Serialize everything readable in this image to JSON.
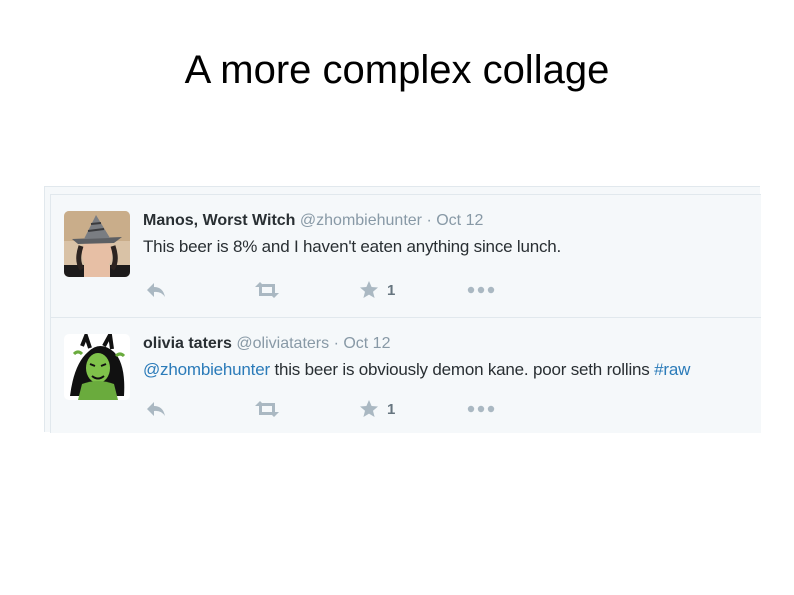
{
  "slide": {
    "title": "A more complex collage"
  },
  "tweets": [
    {
      "fullname": "Manos, Worst Witch",
      "username": "@zhombiehunter",
      "separator": "·",
      "date": "Oct 12",
      "text": "This beer is 8% and I haven't eaten anything since lunch.",
      "favorite_count": "1",
      "actions": [
        "reply-icon",
        "retweet-icon",
        "favorite-star-icon",
        "more-dots-icon"
      ]
    },
    {
      "fullname": "olivia taters",
      "username": "@oliviataters",
      "separator": "·",
      "date": "Oct 12",
      "mention": "@zhombiehunter",
      "text": " this beer is obviously demon kane. poor seth rollins ",
      "hashtag": "#raw",
      "favorite_count": "1",
      "actions": [
        "reply-icon",
        "retweet-icon",
        "favorite-star-icon",
        "more-dots-icon"
      ]
    }
  ],
  "colors": {
    "panel_background": "#f5f8fa",
    "border": "#e1e8ed",
    "name": "#292f33",
    "muted": "#8899a6",
    "link": "#2b7bb9",
    "icon": "#aab8c2"
  }
}
